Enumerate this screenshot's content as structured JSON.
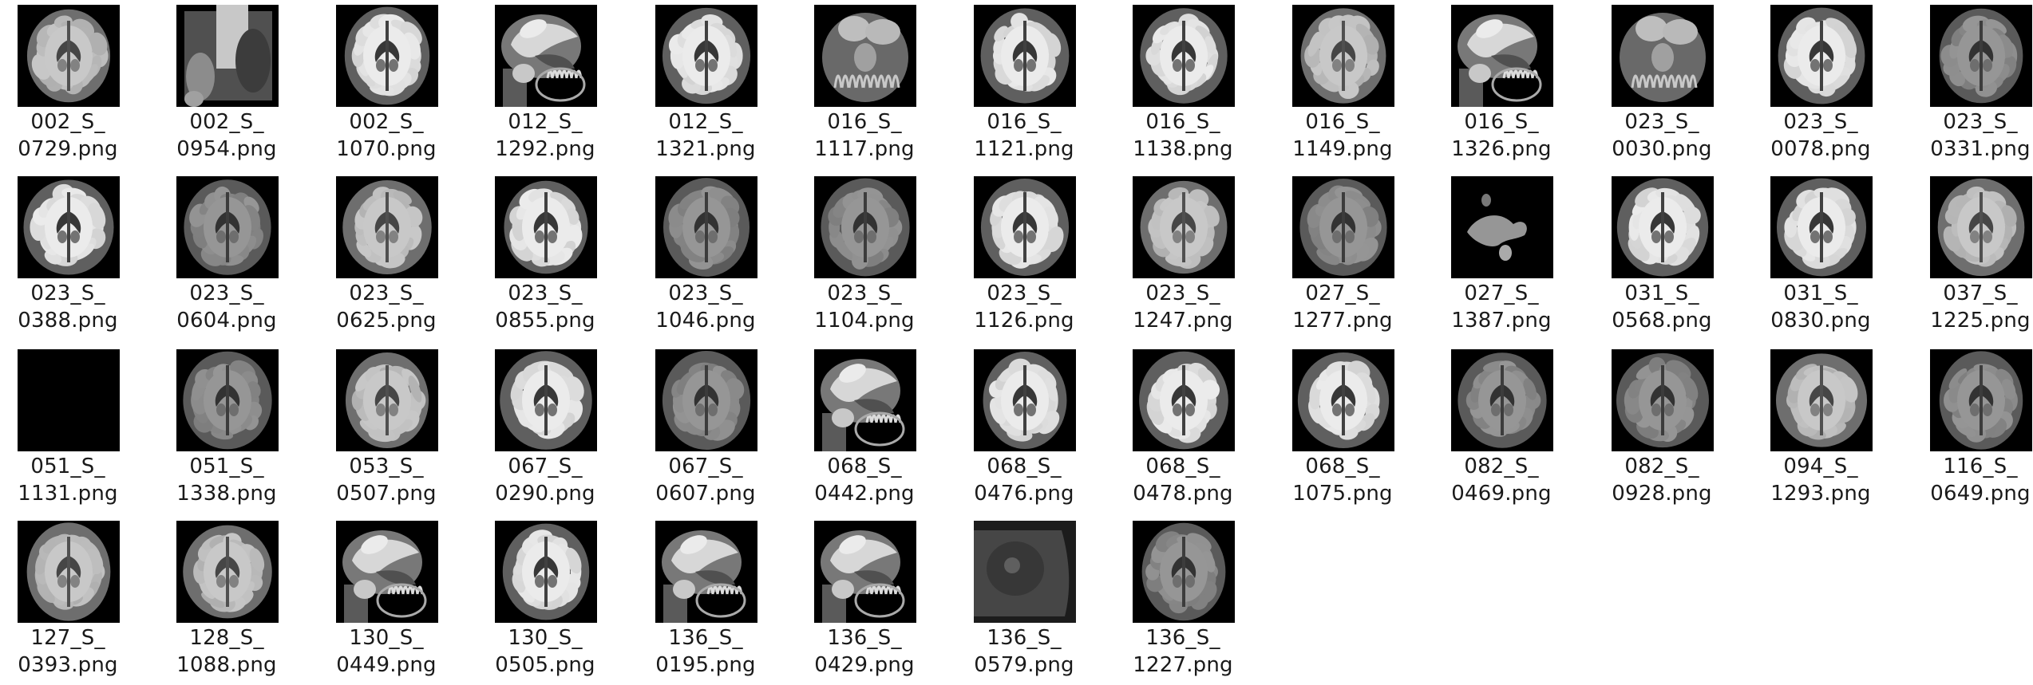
{
  "files": [
    {
      "label_line1": "002_S_",
      "label_line2": "0729.png",
      "thumb_kind": "axial"
    },
    {
      "label_line1": "002_S_",
      "label_line2": "0954.png",
      "thumb_kind": "skull"
    },
    {
      "label_line1": "002_S_",
      "label_line2": "1070.png",
      "thumb_kind": "axial-bright"
    },
    {
      "label_line1": "012_S_",
      "label_line2": "1292.png",
      "thumb_kind": "sagittal"
    },
    {
      "label_line1": "012_S_",
      "label_line2": "1321.png",
      "thumb_kind": "axial-bright"
    },
    {
      "label_line1": "016_S_",
      "label_line2": "1117.png",
      "thumb_kind": "cerebellum"
    },
    {
      "label_line1": "016_S_",
      "label_line2": "1121.png",
      "thumb_kind": "axial-bright"
    },
    {
      "label_line1": "016_S_",
      "label_line2": "1138.png",
      "thumb_kind": "axial-bright"
    },
    {
      "label_line1": "016_S_",
      "label_line2": "1149.png",
      "thumb_kind": "axial"
    },
    {
      "label_line1": "016_S_",
      "label_line2": "1326.png",
      "thumb_kind": "sagittal"
    },
    {
      "label_line1": "023_S_",
      "label_line2": "0030.png",
      "thumb_kind": "cerebellum"
    },
    {
      "label_line1": "023_S_",
      "label_line2": "0078.png",
      "thumb_kind": "axial-bright"
    },
    {
      "label_line1": "023_S_",
      "label_line2": "0331.png",
      "thumb_kind": "axial-dim"
    },
    {
      "label_line1": "023_S_",
      "label_line2": "0388.png",
      "thumb_kind": "axial-bright"
    },
    {
      "label_line1": "023_S_",
      "label_line2": "0604.png",
      "thumb_kind": "axial-dim"
    },
    {
      "label_line1": "023_S_",
      "label_line2": "0625.png",
      "thumb_kind": "axial"
    },
    {
      "label_line1": "023_S_",
      "label_line2": "0855.png",
      "thumb_kind": "axial-bright"
    },
    {
      "label_line1": "023_S_",
      "label_line2": "1046.png",
      "thumb_kind": "axial-dim"
    },
    {
      "label_line1": "023_S_",
      "label_line2": "1104.png",
      "thumb_kind": "axial-dim"
    },
    {
      "label_line1": "023_S_",
      "label_line2": "1126.png",
      "thumb_kind": "axial-bright"
    },
    {
      "label_line1": "023_S_",
      "label_line2": "1247.png",
      "thumb_kind": "axial"
    },
    {
      "label_line1": "027_S_",
      "label_line2": "1277.png",
      "thumb_kind": "axial-dim"
    },
    {
      "label_line1": "027_S_",
      "label_line2": "1387.png",
      "thumb_kind": "fragment"
    },
    {
      "label_line1": "031_S_",
      "label_line2": "0568.png",
      "thumb_kind": "axial-bright"
    },
    {
      "label_line1": "031_S_",
      "label_line2": "0830.png",
      "thumb_kind": "axial-bright"
    },
    {
      "label_line1": "037_S_",
      "label_line2": "1225.png",
      "thumb_kind": "axial"
    },
    {
      "label_line1": "051_S_",
      "label_line2": "1131.png",
      "thumb_kind": "blank"
    },
    {
      "label_line1": "051_S_",
      "label_line2": "1338.png",
      "thumb_kind": "axial-dim"
    },
    {
      "label_line1": "053_S_",
      "label_line2": "0507.png",
      "thumb_kind": "axial"
    },
    {
      "label_line1": "067_S_",
      "label_line2": "0290.png",
      "thumb_kind": "axial-bright"
    },
    {
      "label_line1": "067_S_",
      "label_line2": "0607.png",
      "thumb_kind": "axial-dim"
    },
    {
      "label_line1": "068_S_",
      "label_line2": "0442.png",
      "thumb_kind": "sagittal"
    },
    {
      "label_line1": "068_S_",
      "label_line2": "0476.png",
      "thumb_kind": "axial-bright"
    },
    {
      "label_line1": "068_S_",
      "label_line2": "0478.png",
      "thumb_kind": "axial-bright"
    },
    {
      "label_line1": "068_S_",
      "label_line2": "1075.png",
      "thumb_kind": "axial-bright"
    },
    {
      "label_line1": "082_S_",
      "label_line2": "0469.png",
      "thumb_kind": "axial-dim"
    },
    {
      "label_line1": "082_S_",
      "label_line2": "0928.png",
      "thumb_kind": "axial-dim"
    },
    {
      "label_line1": "094_S_",
      "label_line2": "1293.png",
      "thumb_kind": "axial"
    },
    {
      "label_line1": "116_S_",
      "label_line2": "0649.png",
      "thumb_kind": "axial-dim"
    },
    {
      "label_line1": "127_S_",
      "label_line2": "0393.png",
      "thumb_kind": "axial"
    },
    {
      "label_line1": "128_S_",
      "label_line2": "1088.png",
      "thumb_kind": "axial"
    },
    {
      "label_line1": "130_S_",
      "label_line2": "0449.png",
      "thumb_kind": "sagittal"
    },
    {
      "label_line1": "130_S_",
      "label_line2": "0505.png",
      "thumb_kind": "axial-bright"
    },
    {
      "label_line1": "136_S_",
      "label_line2": "0195.png",
      "thumb_kind": "sagittal"
    },
    {
      "label_line1": "136_S_",
      "label_line2": "0429.png",
      "thumb_kind": "sagittal"
    },
    {
      "label_line1": "136_S_",
      "label_line2": "0579.png",
      "thumb_kind": "skull-side"
    },
    {
      "label_line1": "136_S_",
      "label_line2": "1227.png",
      "thumb_kind": "axial-dim"
    }
  ]
}
